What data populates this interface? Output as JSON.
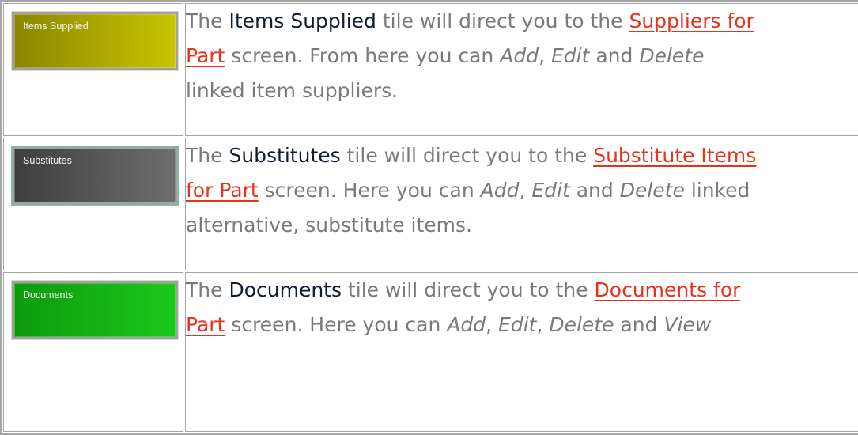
{
  "colors": {
    "items_supplied_tile": "#a8a800",
    "substitutes_tile": "#555555",
    "documents_tile": "#13b013",
    "link": "#e8321c",
    "body_text": "#7a7a7a",
    "strong_text": "#0e1b33",
    "border": "#a5a5a5"
  },
  "rows": [
    {
      "tile_label": "Items Supplied",
      "text_before": "The ",
      "strong": "Items Supplied",
      "text_mid": " tile will direct you to the ",
      "link_line1": "Suppliers for",
      "link_line2": "Part",
      "text_after": " screen. From here you can ",
      "action1": "Add",
      "sep1": ", ",
      "action2": "Edit",
      "sep2": " and ",
      "action3": "Delete",
      "line3": "linked item suppliers."
    },
    {
      "tile_label": "Substitutes",
      "text_before": "The ",
      "strong": "Substitutes",
      "text_mid": " tile will direct you to the ",
      "link_line1": "Substitute Items",
      "link_line2": "for Part",
      "text_after": " screen. Here you can ",
      "action1": "Add",
      "sep1": ", ",
      "action2": "Edit",
      "sep2": " and ",
      "action3": "Delete",
      "tail2": " linked",
      "line3": "alternative, substitute items."
    },
    {
      "tile_label": "Documents",
      "text_before": "The ",
      "strong": "Documents",
      "text_mid": " tile will direct you to the ",
      "link_line1": "Documents for",
      "link_line2": "Part",
      "text_after": " screen. Here you can ",
      "action1": "Add",
      "sep1": ", ",
      "action2": "Edit",
      "sep2": ", ",
      "action3": "Delete",
      "sep3": " and ",
      "action4": "View"
    }
  ]
}
